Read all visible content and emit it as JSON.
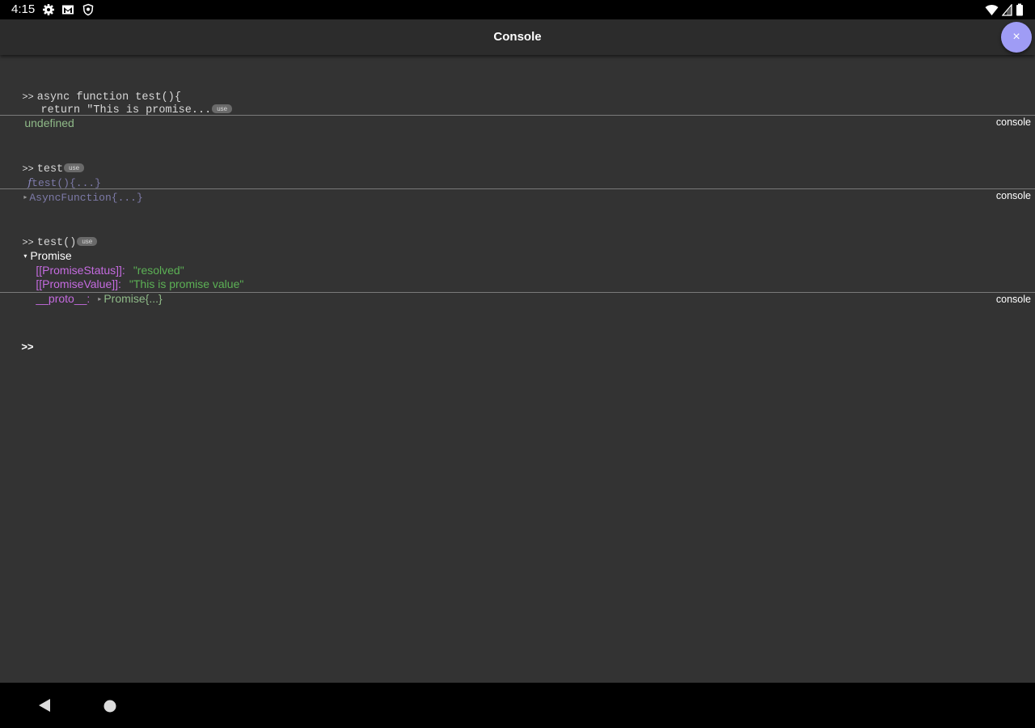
{
  "status_bar": {
    "time": "4:15",
    "left_icons": [
      "gear-icon",
      "gmail-icon",
      "shield-icon"
    ],
    "right_icons": [
      "wifi-icon",
      "cell-signal-icon",
      "battery-icon"
    ]
  },
  "header": {
    "title": "Console",
    "close_label": "×"
  },
  "entries": [
    {
      "prompt": ">>",
      "code_line1": "async function test(){",
      "code_line2": "  return \"This is promise...",
      "use_label": "use",
      "result": "undefined",
      "tag": "console"
    },
    {
      "prompt": ">>",
      "code": "test",
      "use_label": "use",
      "result_f": "f",
      "result_sig": "test(){...}",
      "result_proto": "AsyncFunction{...}",
      "tag": "console"
    },
    {
      "prompt": ">>",
      "code": "test()",
      "use_label": "use",
      "result_label": "Promise",
      "props": [
        {
          "key": "[[PromiseStatus]]:",
          "value": "\"resolved\""
        },
        {
          "key": "[[PromiseValue]]:",
          "value": "\"This is promise value\""
        },
        {
          "key": "__proto__:",
          "value": "Promise{...}"
        }
      ],
      "tag": "console"
    }
  ],
  "input": {
    "prompt": ">>",
    "value": ""
  },
  "navbar": {
    "icons": [
      "back-icon",
      "home-icon"
    ]
  },
  "colors": {
    "background": "#333333",
    "accent_fab": "#9f9cf5",
    "property_key": "#c56be0",
    "string_value": "#5cb155"
  }
}
